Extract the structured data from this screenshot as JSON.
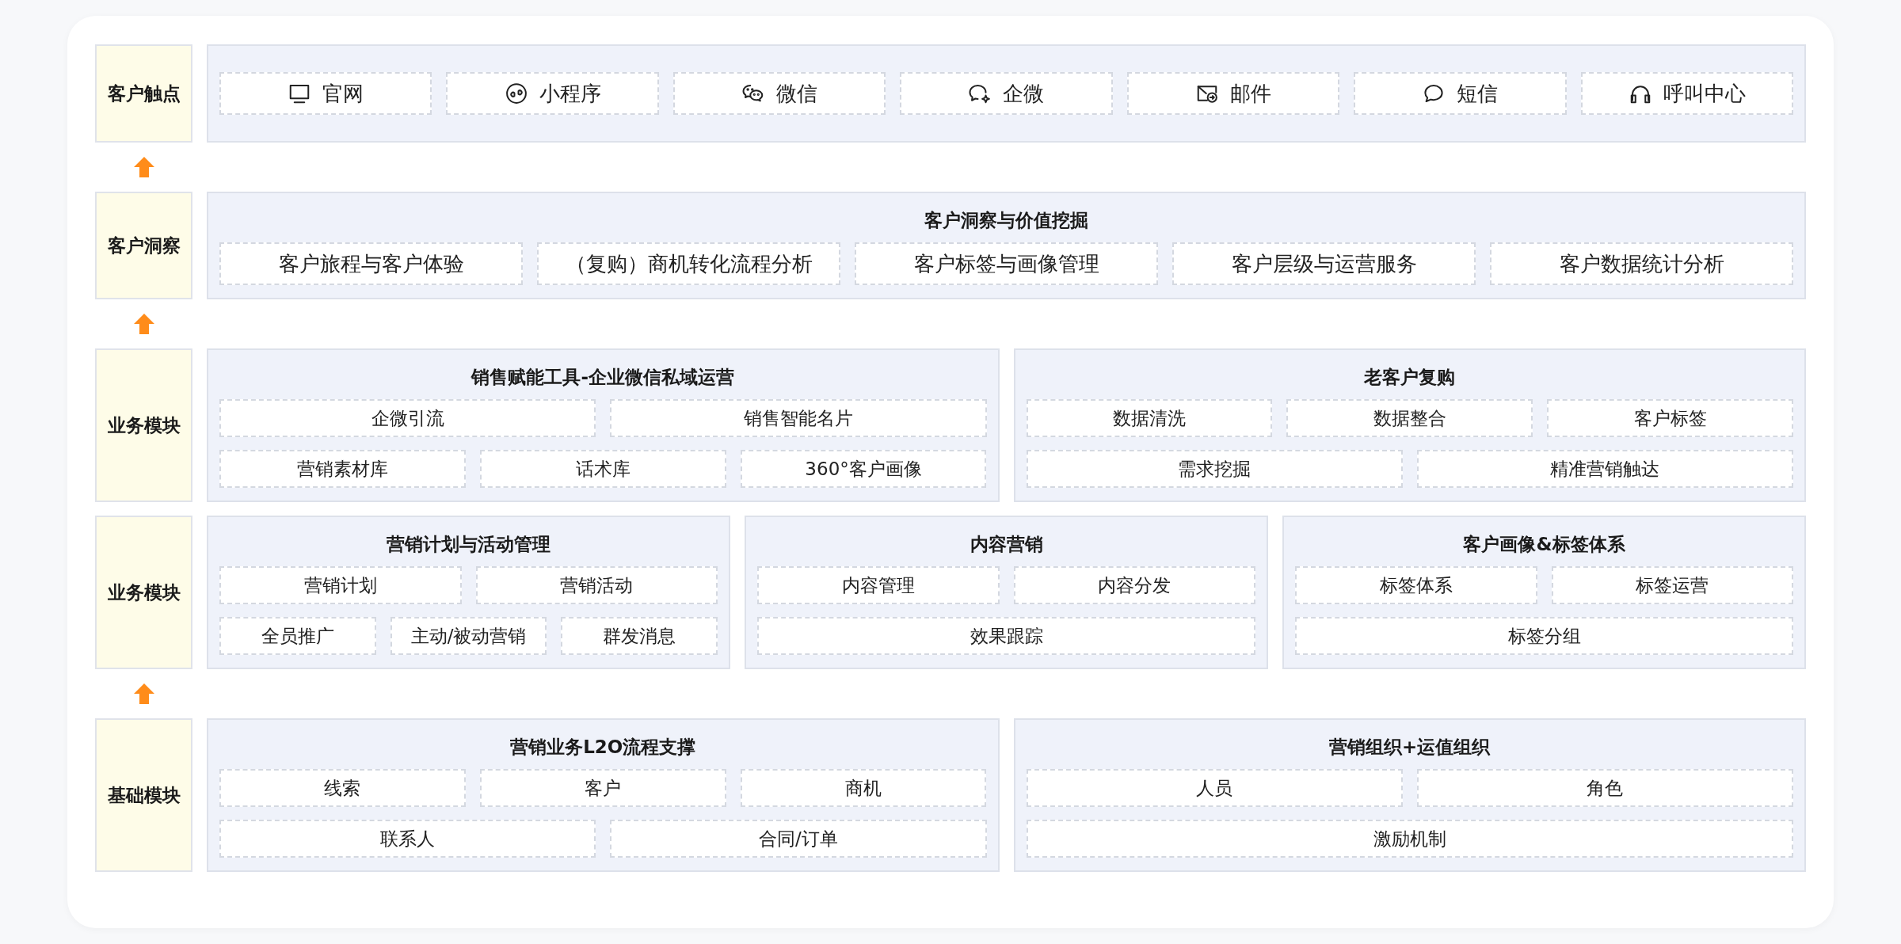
{
  "layers": [
    {
      "label": "客户触点",
      "arrow_below": true,
      "panels": [
        {
          "lines": [
            [
              {
                "text": "官网"
              },
              {
                "text": "小程序"
              },
              {
                "text": "微信"
              },
              {
                "text": "企微"
              },
              {
                "text": "邮件"
              },
              {
                "text": "短信"
              },
              {
                "text": "呼叫中心"
              }
            ]
          ]
        }
      ]
    },
    {
      "label": "客户洞察",
      "arrow_below": true,
      "panels": [
        {
          "title": "客户洞察与价值挖掘",
          "lines": [
            [
              {
                "text": "客户旅程与客户体验"
              },
              {
                "text": "（复购）商机转化流程分析"
              },
              {
                "text": "客户标签与画像管理"
              },
              {
                "text": "客户层级与运营服务"
              },
              {
                "text": "客户数据统计分析"
              }
            ]
          ]
        }
      ]
    },
    {
      "label": "业务模块",
      "arrow_below": false,
      "panels": [
        {
          "title": "销售赋能工具-企业微信私域运营",
          "lines": [
            [
              {
                "text": "企微引流"
              },
              {
                "text": "销售智能名片"
              }
            ],
            [
              {
                "text": "营销素材库"
              },
              {
                "text": "话术库"
              },
              {
                "text": "360°客户画像"
              }
            ]
          ]
        },
        {
          "title": "老客户复购",
          "lines": [
            [
              {
                "text": "数据清洗"
              },
              {
                "text": "数据整合"
              },
              {
                "text": "客户标签"
              }
            ],
            [
              {
                "text": "需求挖掘"
              },
              {
                "text": "精准营销触达"
              }
            ]
          ]
        }
      ]
    },
    {
      "label": "业务模块",
      "arrow_below": true,
      "panels": [
        {
          "title": "营销计划与活动管理",
          "lines": [
            [
              {
                "text": "营销计划"
              },
              {
                "text": "营销活动"
              }
            ],
            [
              {
                "text": "全员推广"
              },
              {
                "text": "主动/被动营销"
              },
              {
                "text": "群发消息"
              }
            ]
          ]
        },
        {
          "title": "内容营销",
          "lines": [
            [
              {
                "text": "内容管理"
              },
              {
                "text": "内容分发"
              }
            ],
            [
              {
                "text": "效果跟踪"
              }
            ]
          ]
        },
        {
          "title": "客户画像&标签体系",
          "lines": [
            [
              {
                "text": "标签体系"
              },
              {
                "text": "标签运营"
              }
            ],
            [
              {
                "text": "标签分组"
              }
            ]
          ]
        }
      ]
    },
    {
      "label": "基础模块",
      "arrow_below": false,
      "panels": [
        {
          "title": "营销业务L2O流程支撑",
          "lines": [
            [
              {
                "text": "线索"
              },
              {
                "text": "客户"
              },
              {
                "text": "商机"
              }
            ],
            [
              {
                "text": "联系人"
              },
              {
                "text": "合同/订单"
              }
            ]
          ]
        },
        {
          "title": "营销组织+运值组织",
          "lines": [
            [
              {
                "text": "人员"
              },
              {
                "text": "角色"
              }
            ],
            [
              {
                "text": "激励机制"
              }
            ]
          ]
        }
      ]
    }
  ]
}
